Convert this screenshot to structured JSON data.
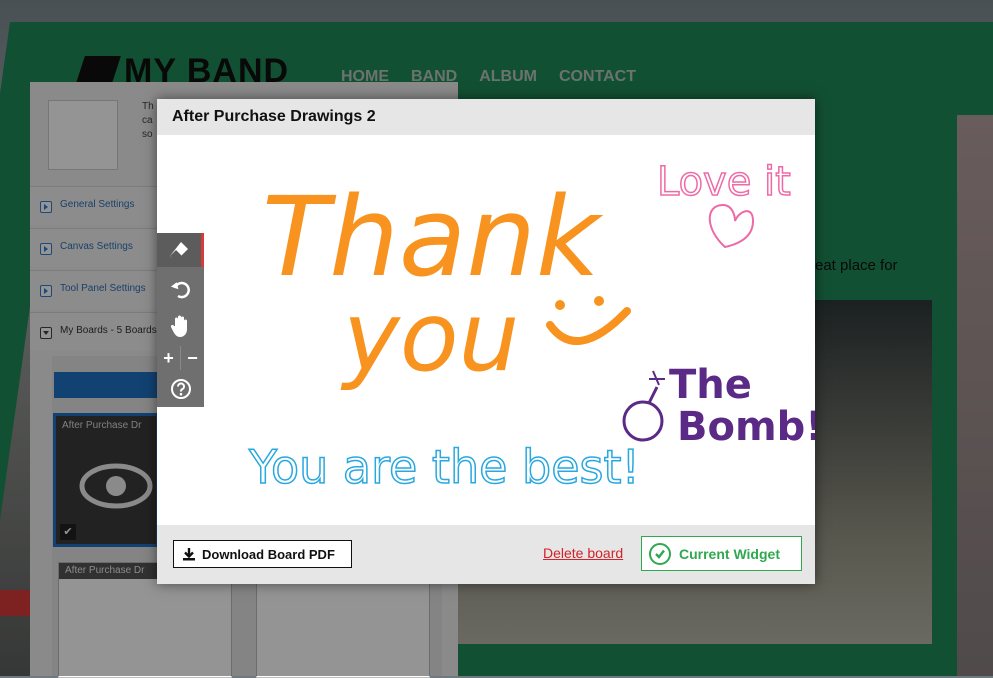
{
  "background_site": {
    "logo_text": "MY BAND",
    "nav": [
      "HOME",
      "BAND",
      "ALBUM",
      "CONTACT"
    ],
    "partial_text": "eat place for"
  },
  "side_panel": {
    "intro_lines": [
      "Th",
      "ca",
      "so"
    ],
    "items": [
      {
        "label": "General Settings"
      },
      {
        "label": "Canvas Settings"
      },
      {
        "label": "Tool Panel Settings"
      },
      {
        "label": "My Boards - 5 Boards"
      }
    ],
    "board_thumbs": [
      {
        "title": "After Purchase Dr"
      },
      {
        "title": "After Purchase Dr"
      }
    ]
  },
  "modal": {
    "title": "After Purchase Drawings 2",
    "drawing_text": {
      "thank": "Thank",
      "you": "you",
      "love_it": "Love it",
      "the": "The",
      "bomb": "Bomb!",
      "best": "You are the best!"
    },
    "footer": {
      "download_label": "Download Board PDF",
      "delete_label": "Delete board",
      "widget_label": "Current Widget"
    }
  },
  "tool_panel": {
    "tools": [
      "eraser-icon",
      "undo-icon",
      "hand-icon",
      "zoom-in-icon",
      "zoom-out-icon",
      "help-icon"
    ],
    "active_tool": "eraser-icon"
  },
  "colors": {
    "accent_green": "#2fa84f",
    "delete_red": "#d2232a",
    "ink_orange": "#f7931e",
    "ink_pink": "#ee6aa7",
    "ink_purple": "#5b2a86",
    "ink_blue": "#29a8e0"
  }
}
